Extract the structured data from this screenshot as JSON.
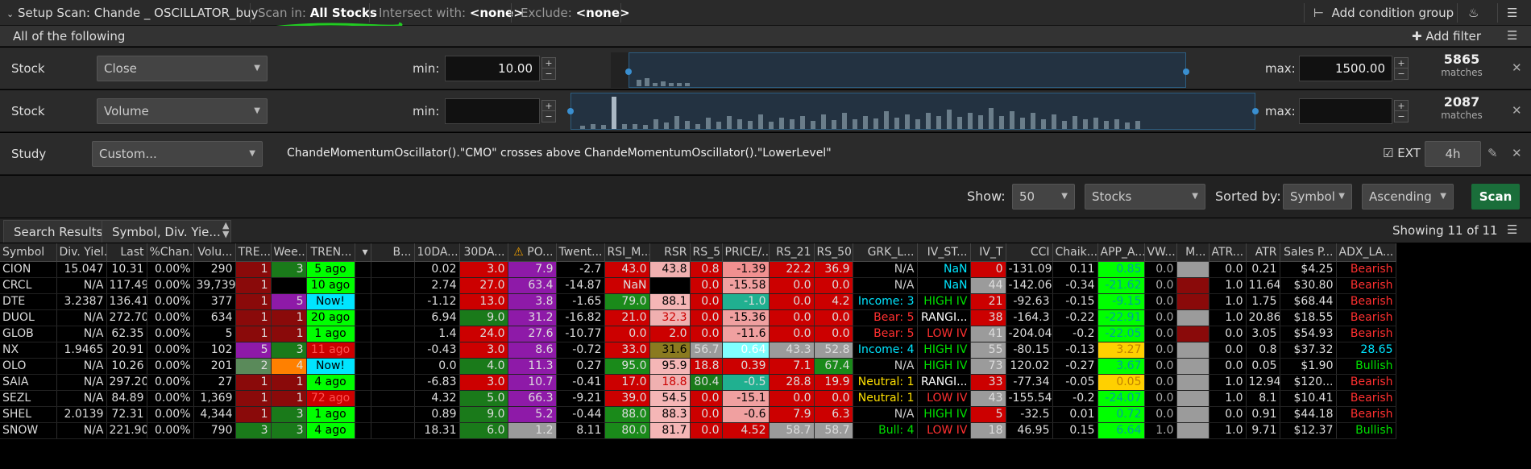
{
  "header": {
    "setup_label": "Setup Scan: Chande _ OSCILLATOR_buy",
    "scan_in_label": "Scan in:",
    "scan_in_value": "All Stocks",
    "intersect_label": "Intersect with:",
    "intersect_value": "<none>",
    "exclude_label": "Exclude:",
    "exclude_value": "<none>",
    "add_condition_group": "Add condition group"
  },
  "filter_bar": {
    "title": "All of the following",
    "add_filter": "Add filter"
  },
  "filters": [
    {
      "type": "Stock",
      "field": "Close",
      "min_label": "min:",
      "min": "10.00",
      "max_label": "max:",
      "max": "1500.00",
      "count": "5865",
      "count_label": "matches",
      "hist": [
        6,
        10,
        4,
        5,
        3,
        4,
        4,
        3,
        3,
        5,
        3,
        3,
        3,
        3,
        3,
        3,
        3,
        3,
        3,
        3,
        3,
        3,
        3,
        3,
        3,
        3,
        3,
        3,
        3,
        3,
        3,
        3,
        3,
        3,
        3,
        3,
        3,
        3,
        3,
        3,
        3,
        3,
        3,
        3,
        3,
        3,
        3,
        3,
        3,
        3,
        3,
        3,
        3,
        3,
        3,
        3,
        3,
        3,
        3,
        3,
        3,
        3,
        3,
        3,
        3,
        3,
        3,
        3,
        3,
        3,
        3,
        3,
        3,
        3,
        3,
        3,
        3,
        3,
        3,
        3,
        3,
        3,
        3,
        3
      ]
    },
    {
      "type": "Stock",
      "field": "Volume",
      "min_label": "min:",
      "min": "",
      "max_label": "max:",
      "max": "",
      "count": "2087",
      "count_label": "matches",
      "hist": [
        4,
        6,
        5,
        40,
        6,
        6,
        5,
        12,
        8,
        16,
        10,
        6,
        14,
        9,
        16,
        12,
        10,
        18,
        9,
        14,
        12,
        16,
        10,
        18,
        11,
        20,
        12,
        16,
        13,
        22,
        14,
        18,
        12,
        20,
        16,
        24,
        15,
        20,
        17,
        26,
        16,
        22,
        14,
        20,
        12,
        18,
        10,
        16,
        12,
        14,
        10,
        12,
        8,
        10
      ]
    },
    {
      "type": "Study",
      "field": "Custom...",
      "expression": "ChandeMomentumOscillator().\"CMO\" crosses above ChandeMomentumOscillator().\"LowerLevel\"",
      "ext_label": "EXT",
      "aggregation": "4h"
    }
  ],
  "controls": {
    "show_label": "Show:",
    "show_value": "50",
    "category": "Stocks",
    "sorted_by_label": "Sorted by:",
    "sorted_by": "Symbol",
    "order": "Ascending",
    "scan_button": "Scan"
  },
  "results": {
    "tab_search": "Search Results",
    "tab_columns": "Symbol, Div. Yie...",
    "showing": "Showing 11 of 11"
  },
  "table": {
    "columns": [
      "Symbol",
      "Div. Yiel...",
      "Last",
      "%Chan...",
      "Volu...",
      "TRE...",
      "Wee...",
      "TREN...",
      "",
      "B...",
      "10DA...",
      "30DA...",
      "PO...",
      "Twent...",
      "RSI_M...",
      "RSR",
      "RS_5",
      "PRICE/...",
      "RS_21",
      "RS_50",
      "GRK_L...",
      "IV_ST...",
      "IV_T",
      "CCI",
      "Chaik...",
      "APP_A...",
      "VW...",
      "M...",
      "ATR...",
      "ATR",
      "Sales P...",
      "ADX_LA..."
    ],
    "rows": [
      [
        "CION",
        "15.047",
        "10.31",
        "0.00%",
        "290",
        "1",
        "3",
        "5 ago",
        "",
        "",
        "0.02",
        "3.0",
        "7.9",
        "-2.7",
        "43.0",
        "43.8",
        "0.8",
        "-1.39",
        "22.2",
        "36.9",
        "N/A",
        "NaN",
        "0",
        "-131.09",
        "0.11",
        "0.85",
        "0.0",
        "",
        "0.0",
        "0.21",
        "$4.25",
        "Bearish"
      ],
      [
        "CRCL",
        "N/A",
        "117.49",
        "0.00%",
        "39,739",
        "1",
        "",
        "10 ago",
        "",
        "",
        "2.74",
        "27.0",
        "63.4",
        "-14.87",
        "NaN",
        "",
        "0.0",
        "-15.58",
        "0.0",
        "0.0",
        "N/A",
        "NaN",
        "44",
        "-142.06",
        "-0.34",
        "-21.62",
        "0.0",
        "",
        "1.0",
        "11.64",
        "$30.80",
        "Bearish"
      ],
      [
        "DTE",
        "3.2387",
        "136.41",
        "0.00%",
        "377",
        "1",
        "5",
        "Now!",
        "",
        "",
        "-1.12",
        "13.0",
        "3.8",
        "-1.65",
        "79.0",
        "88.1",
        "0.0",
        "-1.0",
        "0.0",
        "4.2",
        "Income: 3",
        "HIGH IV",
        "21",
        "-92.63",
        "-0.15",
        "-9.15",
        "0.0",
        "",
        "1.0",
        "1.75",
        "$68.44",
        "Bearish"
      ],
      [
        "DUOL",
        "N/A",
        "272.70",
        "0.00%",
        "634",
        "1",
        "1",
        "20 ago",
        "",
        "",
        "6.94",
        "9.0",
        "31.2",
        "-16.82",
        "21.0",
        "32.3",
        "0.0",
        "-15.36",
        "0.0",
        "0.0",
        "Bear: 5",
        "RANGI...",
        "38",
        "-164.3",
        "-0.22",
        "-22.91",
        "0.0",
        "",
        "1.0",
        "20.86",
        "$18.55",
        "Bearish"
      ],
      [
        "GLOB",
        "N/A",
        "62.35",
        "0.00%",
        "5",
        "1",
        "1",
        "1 ago",
        "",
        "",
        "1.4",
        "24.0",
        "27.6",
        "-10.77",
        "0.0",
        "2.0",
        "0.0",
        "-11.6",
        "0.0",
        "0.0",
        "Bear: 5",
        "LOW IV",
        "41",
        "-204.04",
        "-0.2",
        "-22.05",
        "0.0",
        "",
        "0.0",
        "3.05",
        "$54.93",
        "Bearish"
      ],
      [
        "NX",
        "1.9465",
        "20.91",
        "0.00%",
        "102",
        "5",
        "3",
        "11 ago",
        "",
        "",
        "-0.43",
        "3.0",
        "8.6",
        "-0.72",
        "33.0",
        "31.6",
        "56.7",
        "0.64",
        "43.3",
        "52.8",
        "Income: 4",
        "HIGH IV",
        "55",
        "-80.15",
        "-0.13",
        "3.27",
        "0.0",
        "",
        "0.0",
        "0.8",
        "$37.32",
        "28.65"
      ],
      [
        "OLO",
        "N/A",
        "10.26",
        "0.00%",
        "201",
        "2",
        "4",
        "Now!",
        "",
        "",
        "0.0",
        "4.0",
        "11.3",
        "0.27",
        "95.0",
        "95.9",
        "18.8",
        "0.39",
        "7.1",
        "67.4",
        "N/A",
        "HIGH IV",
        "73",
        "120.02",
        "-0.27",
        "3.67",
        "0.0",
        "",
        "0.0",
        "0.05",
        "$1.90",
        "Bullish"
      ],
      [
        "SAIA",
        "N/A",
        "297.20",
        "0.00%",
        "27",
        "1",
        "1",
        "4 ago",
        "",
        "",
        "-6.83",
        "3.0",
        "10.7",
        "-0.41",
        "17.0",
        "18.8",
        "80.4",
        "-0.5",
        "28.8",
        "19.9",
        "Neutral: 1",
        "RANGI...",
        "33",
        "-77.34",
        "-0.05",
        "0.05",
        "0.0",
        "",
        "1.0",
        "12.94",
        "$120...",
        "Bearish"
      ],
      [
        "SEZL",
        "N/A",
        "84.89",
        "0.00%",
        "1,369",
        "1",
        "1",
        "72 ago",
        "",
        "",
        "4.32",
        "5.0",
        "66.3",
        "-9.21",
        "39.0",
        "54.5",
        "0.0",
        "-15.1",
        "0.0",
        "0.0",
        "Neutral: 1",
        "LOW IV",
        "43",
        "-155.54",
        "-0.2",
        "-24.07",
        "0.0",
        "",
        "1.0",
        "8.1",
        "$10.41",
        "Bearish"
      ],
      [
        "SHEL",
        "2.0139",
        "72.31",
        "0.00%",
        "4,344",
        "1",
        "3",
        "1 ago",
        "",
        "",
        "0.89",
        "9.0",
        "5.2",
        "-0.44",
        "88.0",
        "88.3",
        "0.0",
        "-0.6",
        "7.9",
        "6.3",
        "N/A",
        "HIGH IV",
        "5",
        "-32.5",
        "0.01",
        "0.72",
        "0.0",
        "",
        "0.0",
        "0.91",
        "$44.18",
        "Bearish"
      ],
      [
        "SNOW",
        "N/A",
        "221.90",
        "0.00%",
        "790",
        "3",
        "3",
        "4 ago",
        "",
        "",
        "18.31",
        "6.0",
        "1.2",
        "8.11",
        "80.0",
        "81.7",
        "0.0",
        "4.52",
        "58.7",
        "58.7",
        "Bull: 4",
        "LOW IV",
        "18",
        "46.95",
        "0.15",
        "6.64",
        "1.0",
        "",
        "1.0",
        "9.71",
        "$12.37",
        "Bullish"
      ]
    ]
  },
  "colors": {
    "green": "#00c000",
    "bright_green": "#00ff00",
    "red": "#cc0000",
    "purple": "#8e1aa8",
    "gray": "#9b9b9b",
    "cyan": "#00e5ff",
    "dark_red": "#8a0a0a",
    "accent_green": "#1a6e3a"
  }
}
